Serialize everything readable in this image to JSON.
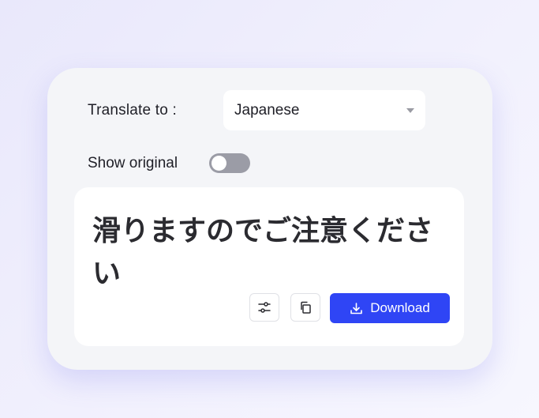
{
  "translate": {
    "label": "Translate to :",
    "selected_language": "Japanese"
  },
  "show_original": {
    "label": "Show original",
    "enabled": false
  },
  "output": {
    "text": "滑りますのでご注意ください"
  },
  "actions": {
    "settings_icon": "sliders-icon",
    "copy_icon": "copy-icon",
    "download_icon": "download-icon",
    "download_label": "Download"
  },
  "colors": {
    "accent": "#2f45f5",
    "toggle_off": "#9b9ca6",
    "card_bg": "#f4f5f8"
  }
}
